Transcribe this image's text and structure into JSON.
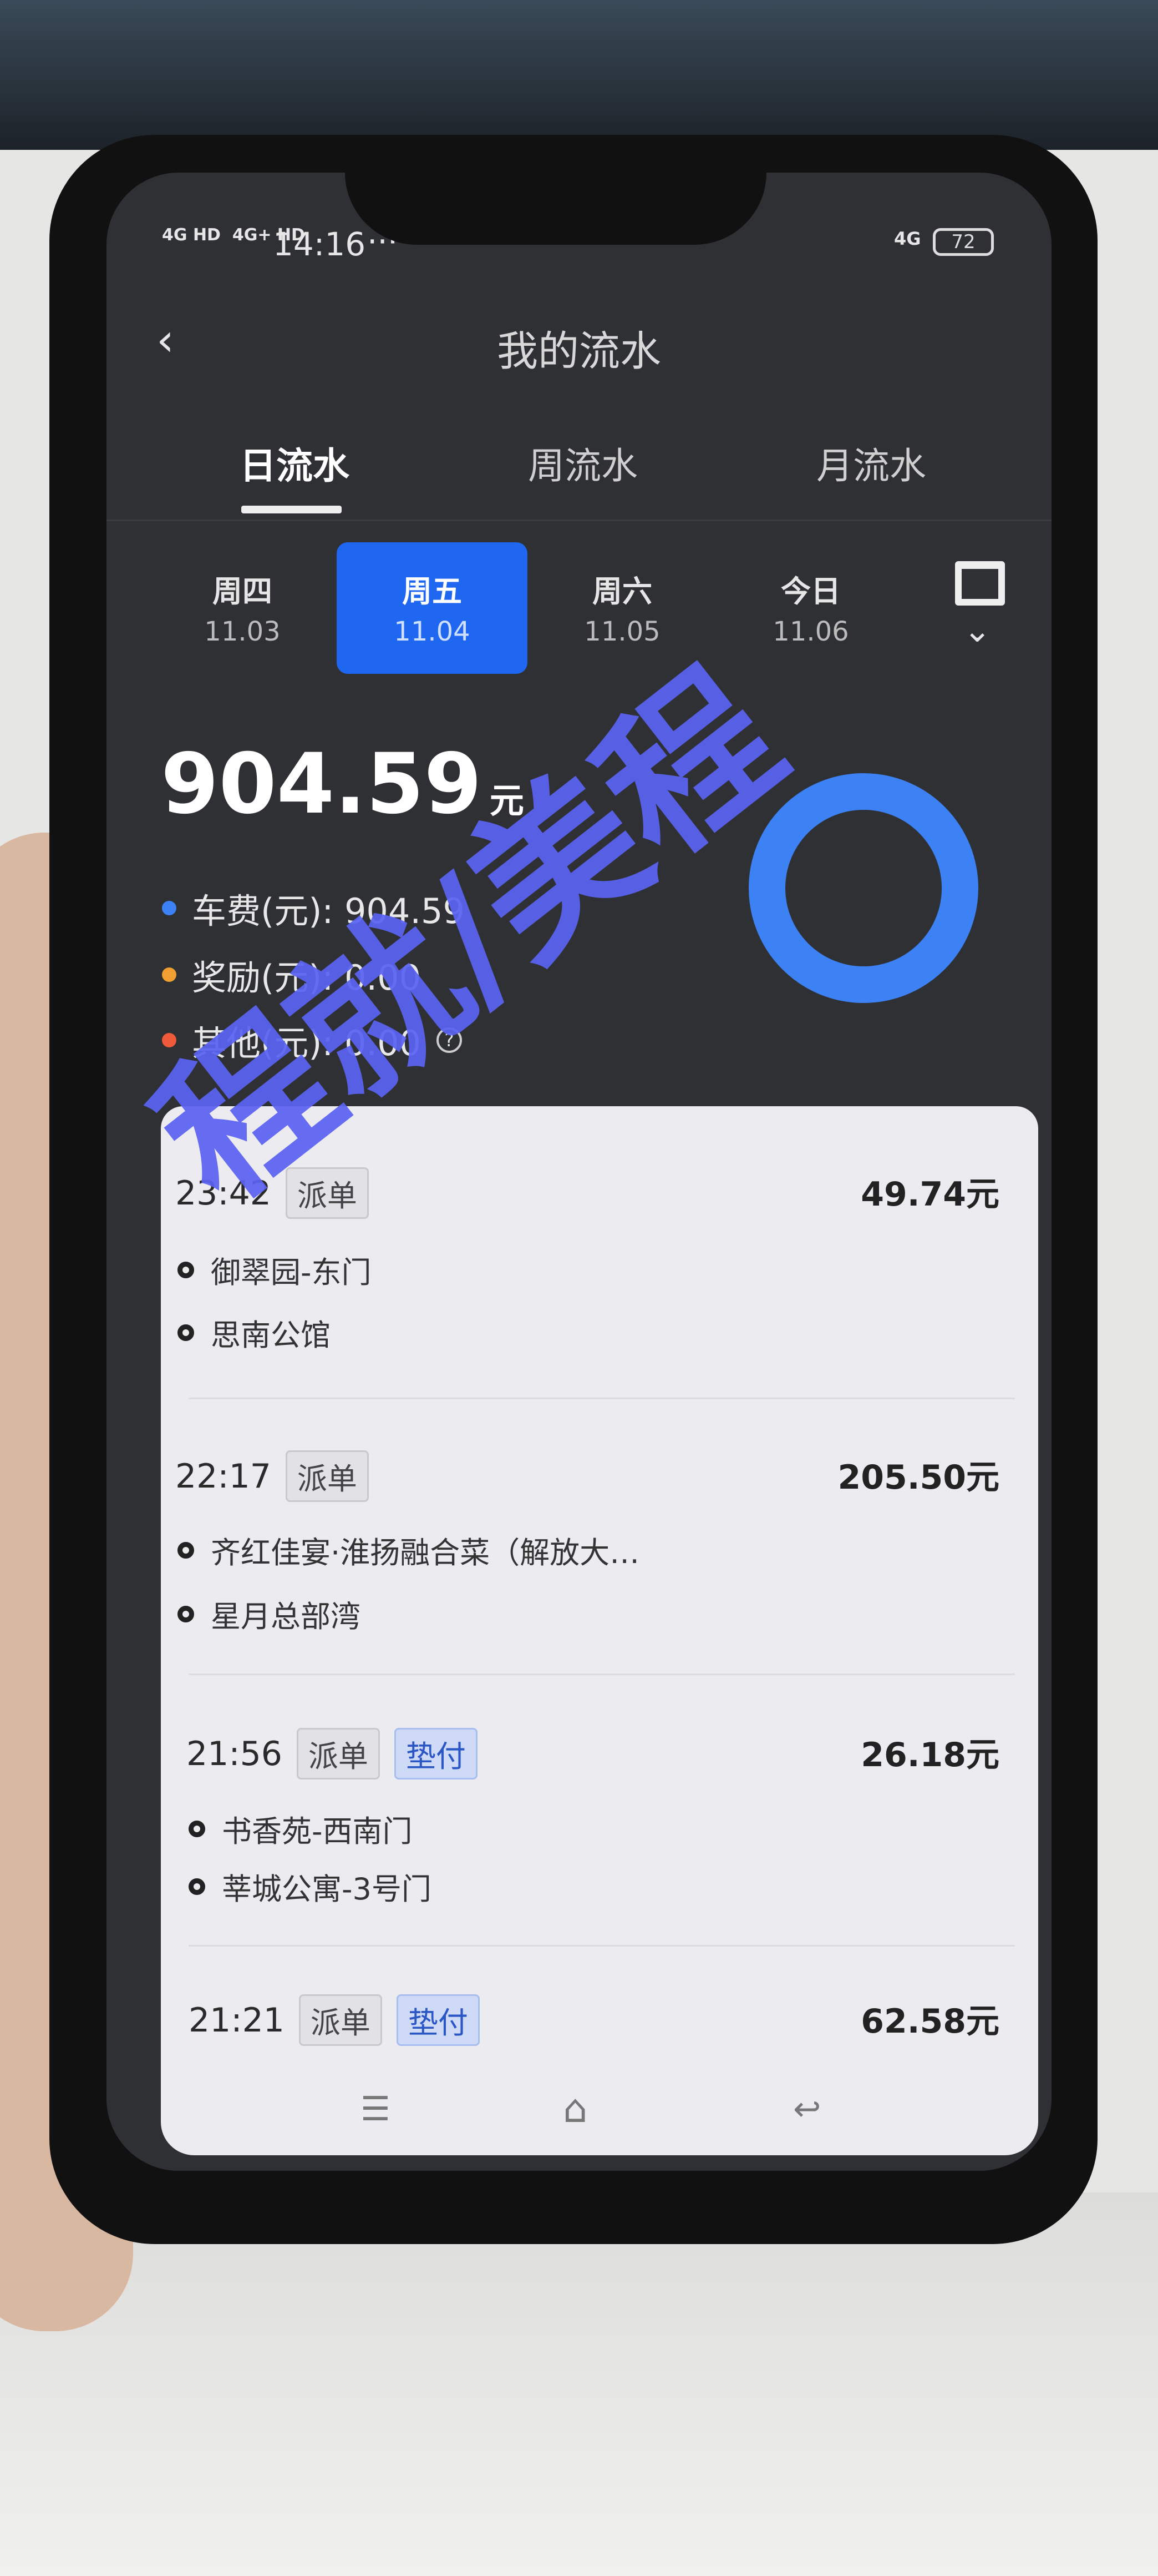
{
  "status_bar": {
    "signal1": "4G HD",
    "signal2": "4G+ HD",
    "time": "14:16",
    "more": "···",
    "network": "4G",
    "battery": "72"
  },
  "header": {
    "title": "我的流水",
    "back_icon": "chevron-left-icon"
  },
  "tabs": [
    {
      "label": "日流水",
      "active": true
    },
    {
      "label": "周流水",
      "active": false
    },
    {
      "label": "月流水",
      "active": false
    }
  ],
  "days": [
    {
      "week": "周四",
      "date": "11.03"
    },
    {
      "week": "周五",
      "date": "11.04",
      "selected": true
    },
    {
      "week": "周六",
      "date": "11.05"
    },
    {
      "week": "今日",
      "date": "11.06"
    }
  ],
  "calendar_icon": "calendar-icon",
  "summary": {
    "total": "904.59",
    "unit": "元",
    "items": [
      {
        "label": "车费(元): 904.59",
        "color": "#3d82f5"
      },
      {
        "label": "奖励(元): 0.00",
        "color": "#f0a030"
      },
      {
        "label": "其他(元): 0.00",
        "color": "#ef5a3a"
      }
    ],
    "help_icon": "question-circle-icon",
    "ring_color": "#3d82f5",
    "fare_share_percent": 100
  },
  "orders": [
    {
      "time": "23:42",
      "badges": [
        "派单"
      ],
      "amount": "49.74元",
      "from": "御翠园-东门",
      "to": "思南公馆"
    },
    {
      "time": "22:17",
      "badges": [
        "派单"
      ],
      "amount": "205.50元",
      "from": "齐红佳宴·淮扬融合菜（解放大…",
      "to": "星月总部湾"
    },
    {
      "time": "21:56",
      "badges": [
        "派单",
        "垫付"
      ],
      "amount": "26.18元",
      "from": "书香苑-西南门",
      "to": "莘城公寓-3号门"
    },
    {
      "time": "21:21",
      "badges": [
        "派单",
        "垫付"
      ],
      "amount": "62.58元"
    }
  ],
  "watermark": "程就/美程"
}
